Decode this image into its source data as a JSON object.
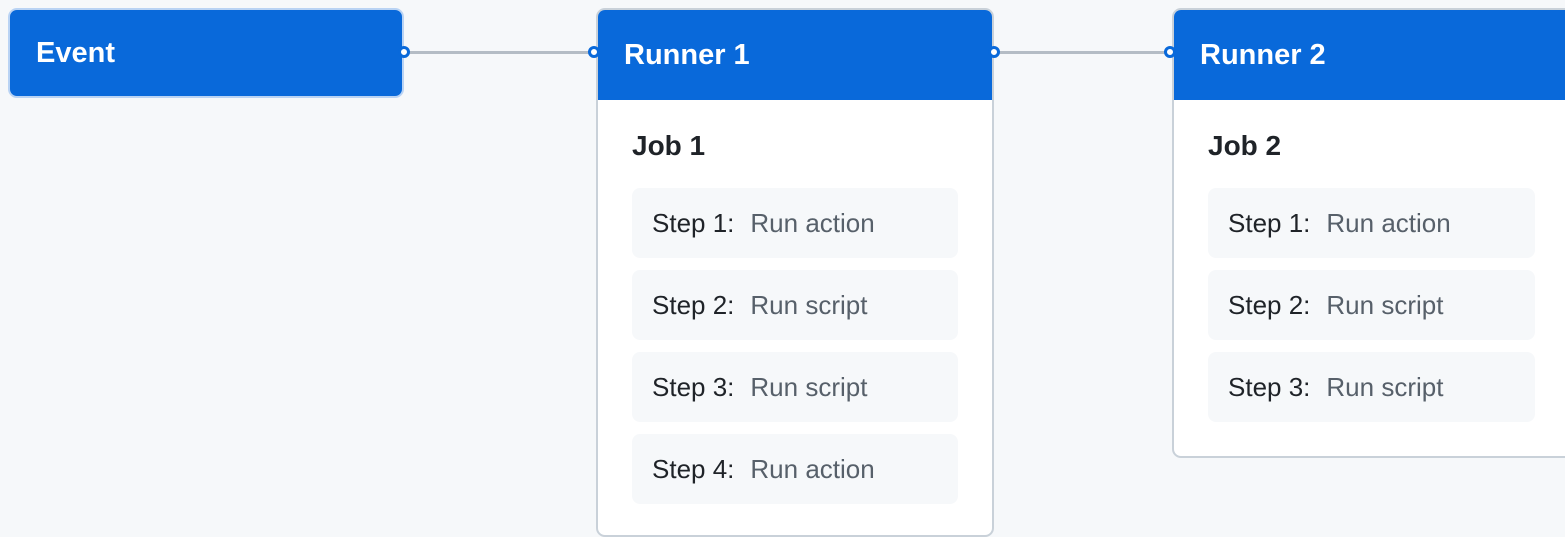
{
  "colors": {
    "background": "#f6f8fa",
    "node_blue": "#0969da",
    "connector": "#b4bcc5",
    "card_bg": "#ffffff",
    "step_bg": "#f6f8fa",
    "step_text": "#1f2328",
    "step_action_text": "#57606a"
  },
  "event": {
    "label": "Event"
  },
  "runners": [
    {
      "label": "Runner 1",
      "job": {
        "title": "Job 1",
        "steps": [
          {
            "label": "Step 1:",
            "action": "Run action"
          },
          {
            "label": "Step 2:",
            "action": "Run script"
          },
          {
            "label": "Step 3:",
            "action": "Run script"
          },
          {
            "label": "Step 4:",
            "action": "Run action"
          }
        ]
      }
    },
    {
      "label": "Runner 2",
      "job": {
        "title": "Job 2",
        "steps": [
          {
            "label": "Step 1:",
            "action": "Run action"
          },
          {
            "label": "Step 2:",
            "action": "Run script"
          },
          {
            "label": "Step 3:",
            "action": "Run script"
          }
        ]
      }
    }
  ]
}
